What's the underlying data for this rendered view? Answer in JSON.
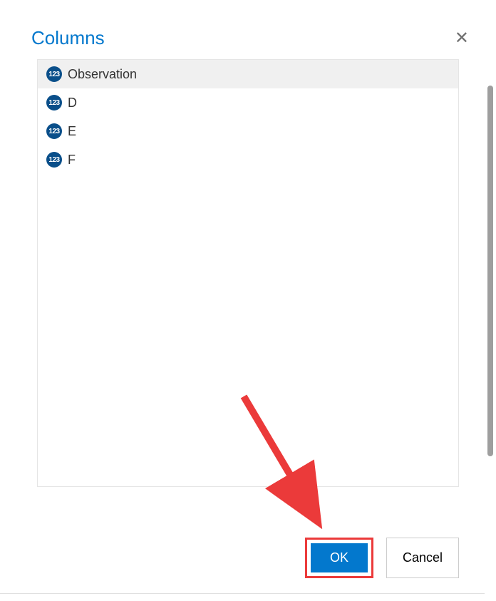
{
  "dialog": {
    "title": "Columns",
    "columns": [
      {
        "label": "Observation",
        "icon": "123",
        "selected": true
      },
      {
        "label": "D",
        "icon": "123",
        "selected": false
      },
      {
        "label": "E",
        "icon": "123",
        "selected": false
      },
      {
        "label": "F",
        "icon": "123",
        "selected": false
      }
    ],
    "buttons": {
      "ok": "OK",
      "cancel": "Cancel"
    }
  }
}
